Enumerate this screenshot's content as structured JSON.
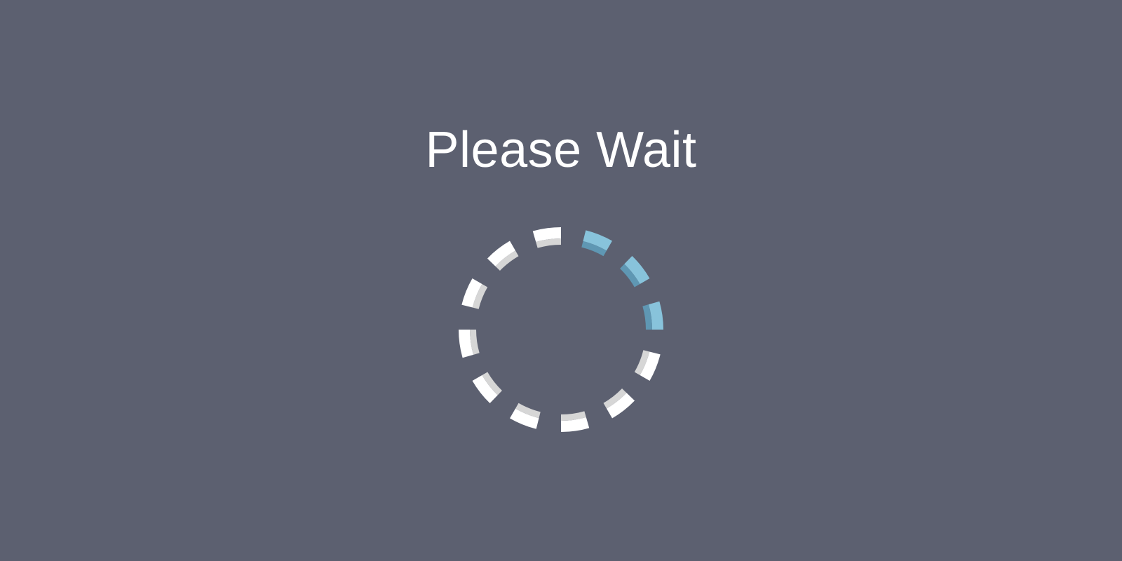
{
  "loading_screen": {
    "title": "Please Wait",
    "spinner": {
      "segment_count": 12,
      "active_segments": [
        0,
        1,
        2
      ],
      "colors": {
        "background": "#5c6070",
        "segment": "#ffffff",
        "segment_inner": "#d6d6d6",
        "active": "#88c3db",
        "active_inner": "#5f97b3"
      }
    }
  }
}
